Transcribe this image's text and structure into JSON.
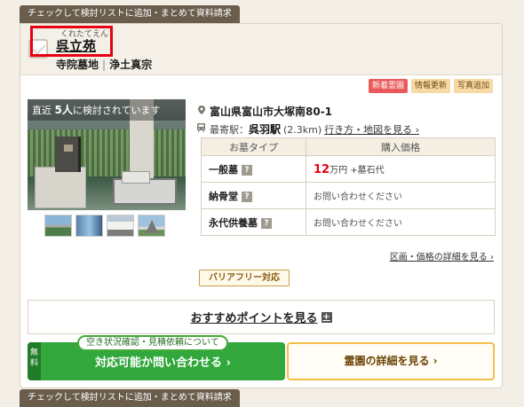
{
  "top_tag": "チェックして検討リストに追加・まとめて資料請求",
  "facility": {
    "ruby": "くれたてえん",
    "name": "呉立苑",
    "category": "寺院墓地",
    "separator": "|",
    "sect": "浄土真宗"
  },
  "badges": {
    "new": "新着霊園",
    "info": "情報更新",
    "photo": "写真追加"
  },
  "photo": {
    "prefix": "直近 ",
    "count": "5人",
    "suffix": "に検討されています"
  },
  "location": {
    "address": "富山県富山市大塚南80-1",
    "station_label": "最寄駅：",
    "station": "呉羽駅",
    "distance": "(2.3km)",
    "route_link": "行き方・地図を見る ›"
  },
  "table": {
    "headers": [
      "お墓タイプ",
      "購入価格"
    ],
    "rows": [
      {
        "type": "一般墓",
        "price": "12",
        "price_unit": "万円 +墓石代"
      },
      {
        "type": "納骨堂",
        "price": "お問い合わせください"
      },
      {
        "type": "永代供養墓",
        "price": "お問い合わせください"
      }
    ],
    "question_mark": "?"
  },
  "detail_link": "区画・価格の詳細を見る ›",
  "barrier_free": "バリアフリー対応",
  "points_button": "おすすめポイントを見る",
  "plus_icon": "+",
  "availability_note": "空き状況確認・見積依頼について",
  "free_tag": "無料",
  "contact_button": "対応可能か問い合わせる ›",
  "cemetery_button": "霊園の詳細を見る ›",
  "bottom_tag": "チェックして検討リストに追加・まとめて資料請求"
}
